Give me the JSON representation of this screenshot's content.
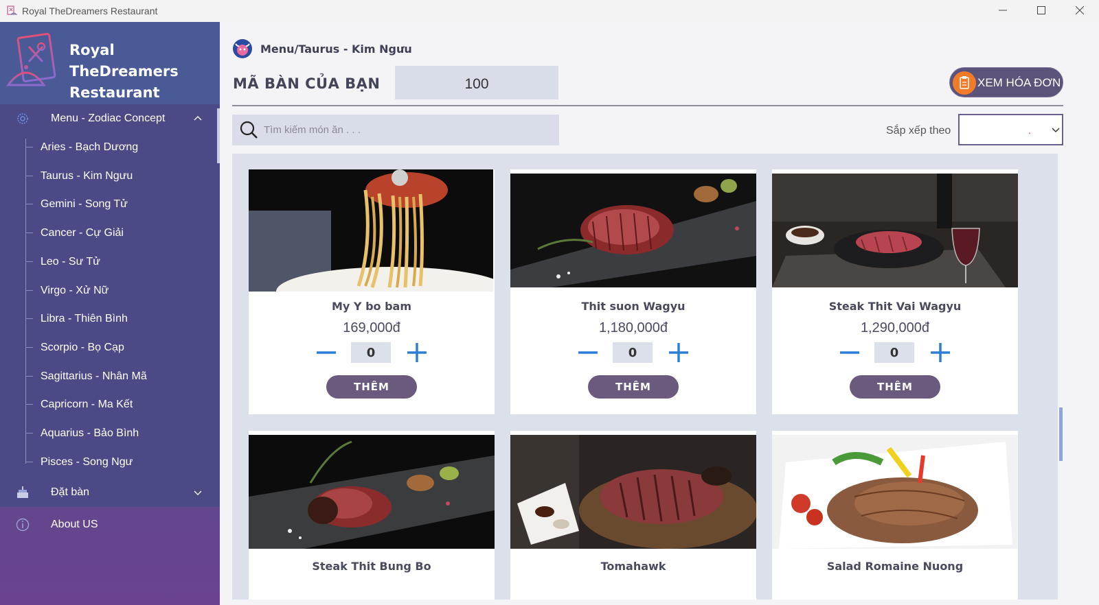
{
  "window": {
    "title": "Royal TheDreamers Restaurant",
    "controls": [
      "minimize-icon",
      "maximize-icon",
      "close-icon"
    ]
  },
  "brand": {
    "line1": "Royal TheDreamers",
    "line2": "Restaurant ★★★★★"
  },
  "sidebar": {
    "menu_group": {
      "label": "Menu - Zodiac Concept",
      "items": [
        {
          "label": "Aries - Bạch Dương"
        },
        {
          "label": "Taurus - Kim Ngưu"
        },
        {
          "label": "Gemini - Song Tử"
        },
        {
          "label": "Cancer - Cự Giải"
        },
        {
          "label": "Leo - Sư Tử"
        },
        {
          "label": "Virgo - Xử Nữ"
        },
        {
          "label": "Libra - Thiên Bình"
        },
        {
          "label": "Scorpio - Bọ Cạp"
        },
        {
          "label": "Sagittarius - Nhân Mã"
        },
        {
          "label": "Capricorn - Ma Kết"
        },
        {
          "label": "Aquarius - Bảo Bình"
        },
        {
          "label": "Pisces - Song Ngư"
        }
      ]
    },
    "booking": {
      "label": "Đặt bàn"
    },
    "about": {
      "label": "About US"
    }
  },
  "header": {
    "breadcrumb": "Menu/Taurus - Kim Ngưu",
    "table_label": "MÃ BÀN CỦA BẠN",
    "table_value": "100",
    "invoice_button": "XEM HÓA ĐƠN"
  },
  "search": {
    "placeholder": "Tìm kiếm món ăn . . ."
  },
  "sort": {
    "label": "Sắp xếp theo",
    "value": "."
  },
  "dishes": [
    {
      "name": "My Y bo bam",
      "price": "169,000đ",
      "qty": "0",
      "add_label": "THÊM"
    },
    {
      "name": "Thit suon Wagyu",
      "price": "1,180,000đ",
      "qty": "0",
      "add_label": "THÊM"
    },
    {
      "name": "Steak Thit Vai Wagyu",
      "price": "1,290,000đ",
      "qty": "0",
      "add_label": "THÊM"
    },
    {
      "name": "Steak Thit Bung Bo"
    },
    {
      "name": "Tomahawk"
    },
    {
      "name": "Salad Romaine Nuong"
    }
  ],
  "colors": {
    "sidebar_top": "#4a4f86",
    "sidebar_bottom": "#6a4390",
    "accent_button": "#6a5a7e",
    "plus_minus": "#2b7fd8",
    "invoice_icon": "#f07c29"
  }
}
